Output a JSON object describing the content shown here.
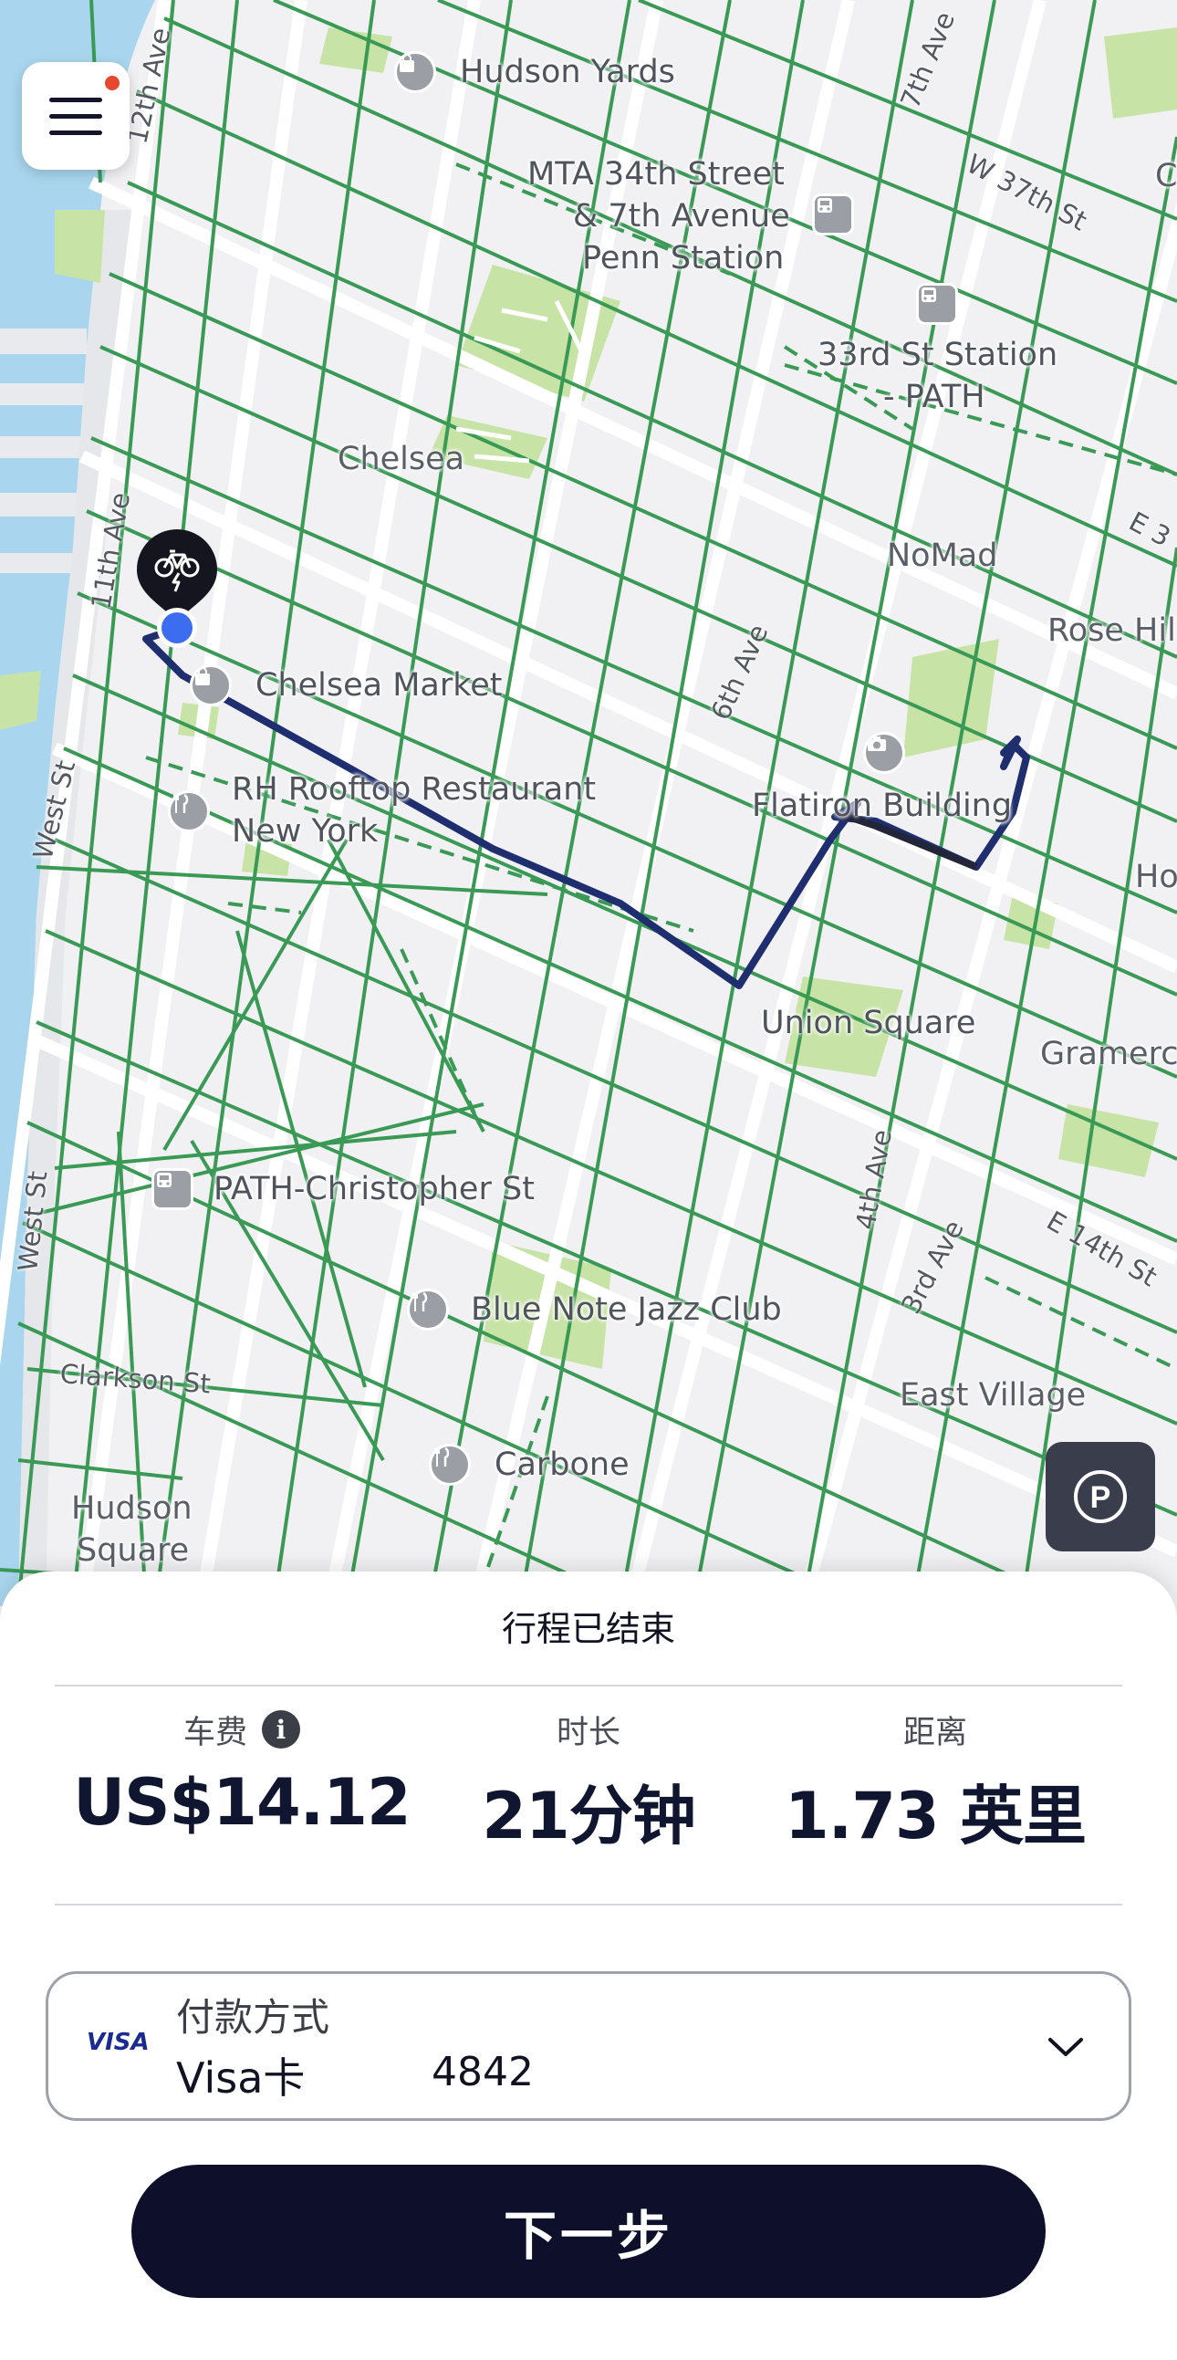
{
  "map": {
    "labels": {
      "hudson_yards": "Hudson Yards",
      "mta": [
        "MTA 34th Street",
        "& 7th Avenue",
        "Penn Station"
      ],
      "station_33rd": [
        "33rd St Station",
        "- PATH"
      ],
      "chelsea": "Chelsea",
      "nomad": "NoMad",
      "rose_hill": "Rose Hill",
      "chelsea_market": "Chelsea Market",
      "rh_rooftop": [
        "RH Rooftop Restaurant",
        "New York"
      ],
      "flatiron": "Flatiron Building",
      "union_square": "Union Square",
      "gramercy": "Gramercy",
      "path_christopher": "PATH-Christopher St",
      "blue_note": "Blue Note Jazz Club",
      "east_village": "East Village",
      "carbone": "Carbone",
      "hudson_square": [
        "Hudson",
        "Square"
      ],
      "clarkson": "Clarkson St",
      "ho": "Ho",
      "c_edge": "C",
      "e3_edge": "E 3"
    },
    "streets": {
      "ave12": "12th Ave",
      "ave11": "11th Ave",
      "ave7": "7th Ave",
      "w37": "W 37th St",
      "ave6": "6th Ave",
      "ave4": "4th Ave",
      "ave3": "3rd Ave",
      "e14": "E 14th St",
      "west_st_1": "West St",
      "west_st_2": "West St"
    },
    "route_color": "#1f2e6e",
    "bike_lane_color": "#3a9a55",
    "water_color": "#a9d6ee",
    "park_color": "#c7e3a6"
  },
  "menu": {
    "icon": "hamburger-icon",
    "notification": true
  },
  "parking_button": {
    "icon": "parking-icon",
    "symbol": "P"
  },
  "summary": {
    "title": "行程已结束",
    "fare_label": "车费",
    "fare_value": "US$14.12",
    "info_symbol": "i",
    "duration_label": "时长",
    "duration_value": "21分钟",
    "distance_label": "距离",
    "distance_value": "1.73 英里"
  },
  "payment": {
    "brand": "VISA",
    "label": "付款方式",
    "card": "Visa卡",
    "last4": "4842"
  },
  "next_button": "下一步"
}
